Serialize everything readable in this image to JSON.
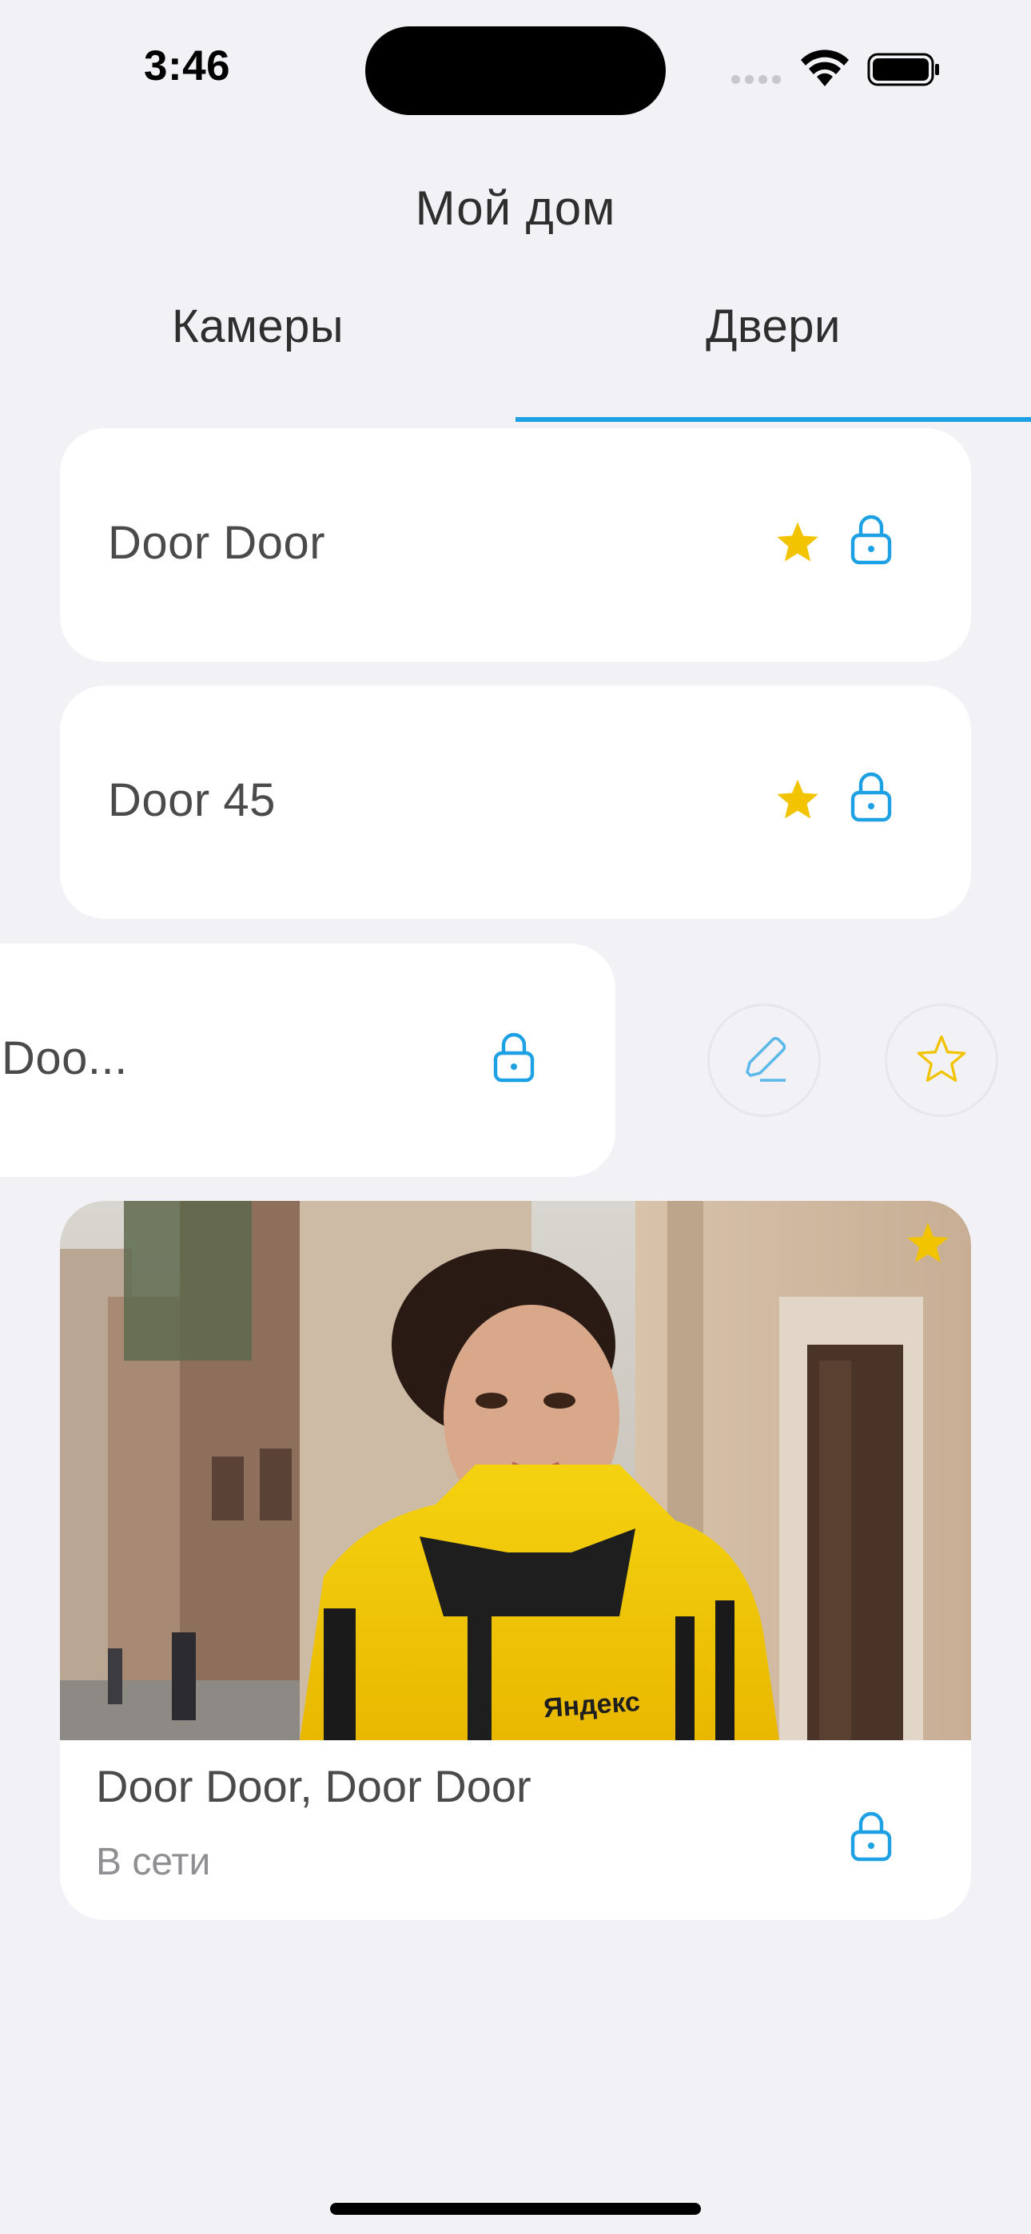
{
  "status_bar": {
    "time": "3:46"
  },
  "header": {
    "title": "Мой дом"
  },
  "tabs": [
    {
      "label": "Камеры",
      "active": false
    },
    {
      "label": "Двери",
      "active": true
    }
  ],
  "doors": [
    {
      "name": "Door Door",
      "favorite": true
    },
    {
      "name": "Door 45",
      "favorite": true
    },
    {
      "name": "Doo...",
      "favorite": false,
      "swiped": true
    }
  ],
  "camera_door": {
    "title": "Door Door, Door Door",
    "status": "В сети",
    "favorite": true,
    "photo_sign_text": "Яндекс"
  },
  "icons": {
    "favorite": "star-icon",
    "lock": "lock-icon",
    "edit": "pencil-icon",
    "add_favorite": "star-outline-icon"
  },
  "colors": {
    "accent": "#1EA1E4",
    "star": "#F2C400",
    "background": "#F1F1F6"
  }
}
